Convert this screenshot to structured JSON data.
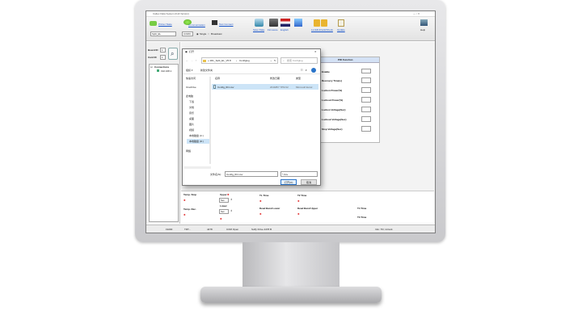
{
  "app": {
    "title": "Caltex Data System (Full Version)",
    "toolbar": {
      "printer_state": "Printer State",
      "communication": "Communication",
      "test_connect": "Test Connect",
      "model_value": "Split_EL",
      "port_value": "COM3",
      "single": "Single",
      "broadcast": "Broadcast",
      "save_data": "Save Data",
      "firmware": "Firmware",
      "english": "English",
      "lock_unlock": "Lock&Unlock/Check",
      "update": "Update",
      "help": "Help"
    },
    "left": {
      "board_id_label": "Board ID",
      "board_id_value": "1",
      "card_id_label": "Card ID",
      "card_id_value": "1",
      "tree_root": "Connections",
      "tree_child": "192.168.1"
    },
    "status_bar": [
      "19200",
      "TRT...",
      "4478",
      "COM Open",
      "Soffy Drive 4478 B",
      "Info: TR, Unlock"
    ]
  },
  "pid_panel": {
    "title": "PID Function",
    "rows": [
      "Enable",
      "Recovery Time(s)",
      "Lockon Power(%)",
      "Lockout Power(%)",
      "Lockon Voltage(Sec)",
      "Lockout Voltage(Sec)",
      "Stop Voltage(Sec)"
    ]
  },
  "bottom": {
    "labels": [
      "Temp. Stop",
      "Upper",
      "TL Time",
      "T2 Time",
      "Temp. Rec.",
      "Lower",
      "Dead Band Lower",
      "Dead Band Upper",
      "T4 Time",
      "T3 Time"
    ],
    "sel1": "Set",
    "sel2": "Set"
  },
  "dialog": {
    "title": "打开",
    "path": [
      "« 1DL_Split_EL_V5.8",
      "Configlog"
    ],
    "search_placeholder": "搜索 Configlog",
    "organize": "组织 ▾",
    "new_folder": "新建文件夹",
    "columns": [
      "名称",
      "修改日期",
      "类型"
    ],
    "file": {
      "name": "Config_ID1.csv",
      "date": "2019/8/7 7PM 02",
      "type": "Microsoft Excel"
    },
    "nav": [
      "快速访问",
      "OneDrive",
      "此电脑",
      "下载",
      "文档",
      "音乐",
      "桌面",
      "图片",
      "视频",
      "本地磁盘 (C:)",
      "本地磁盘 (D:)",
      "网络"
    ],
    "filename_label": "文件名(N):",
    "filename_value": "Config_ID1.csv",
    "filter": "*.Csv",
    "open": "打开(O)",
    "cancel": "取消"
  }
}
